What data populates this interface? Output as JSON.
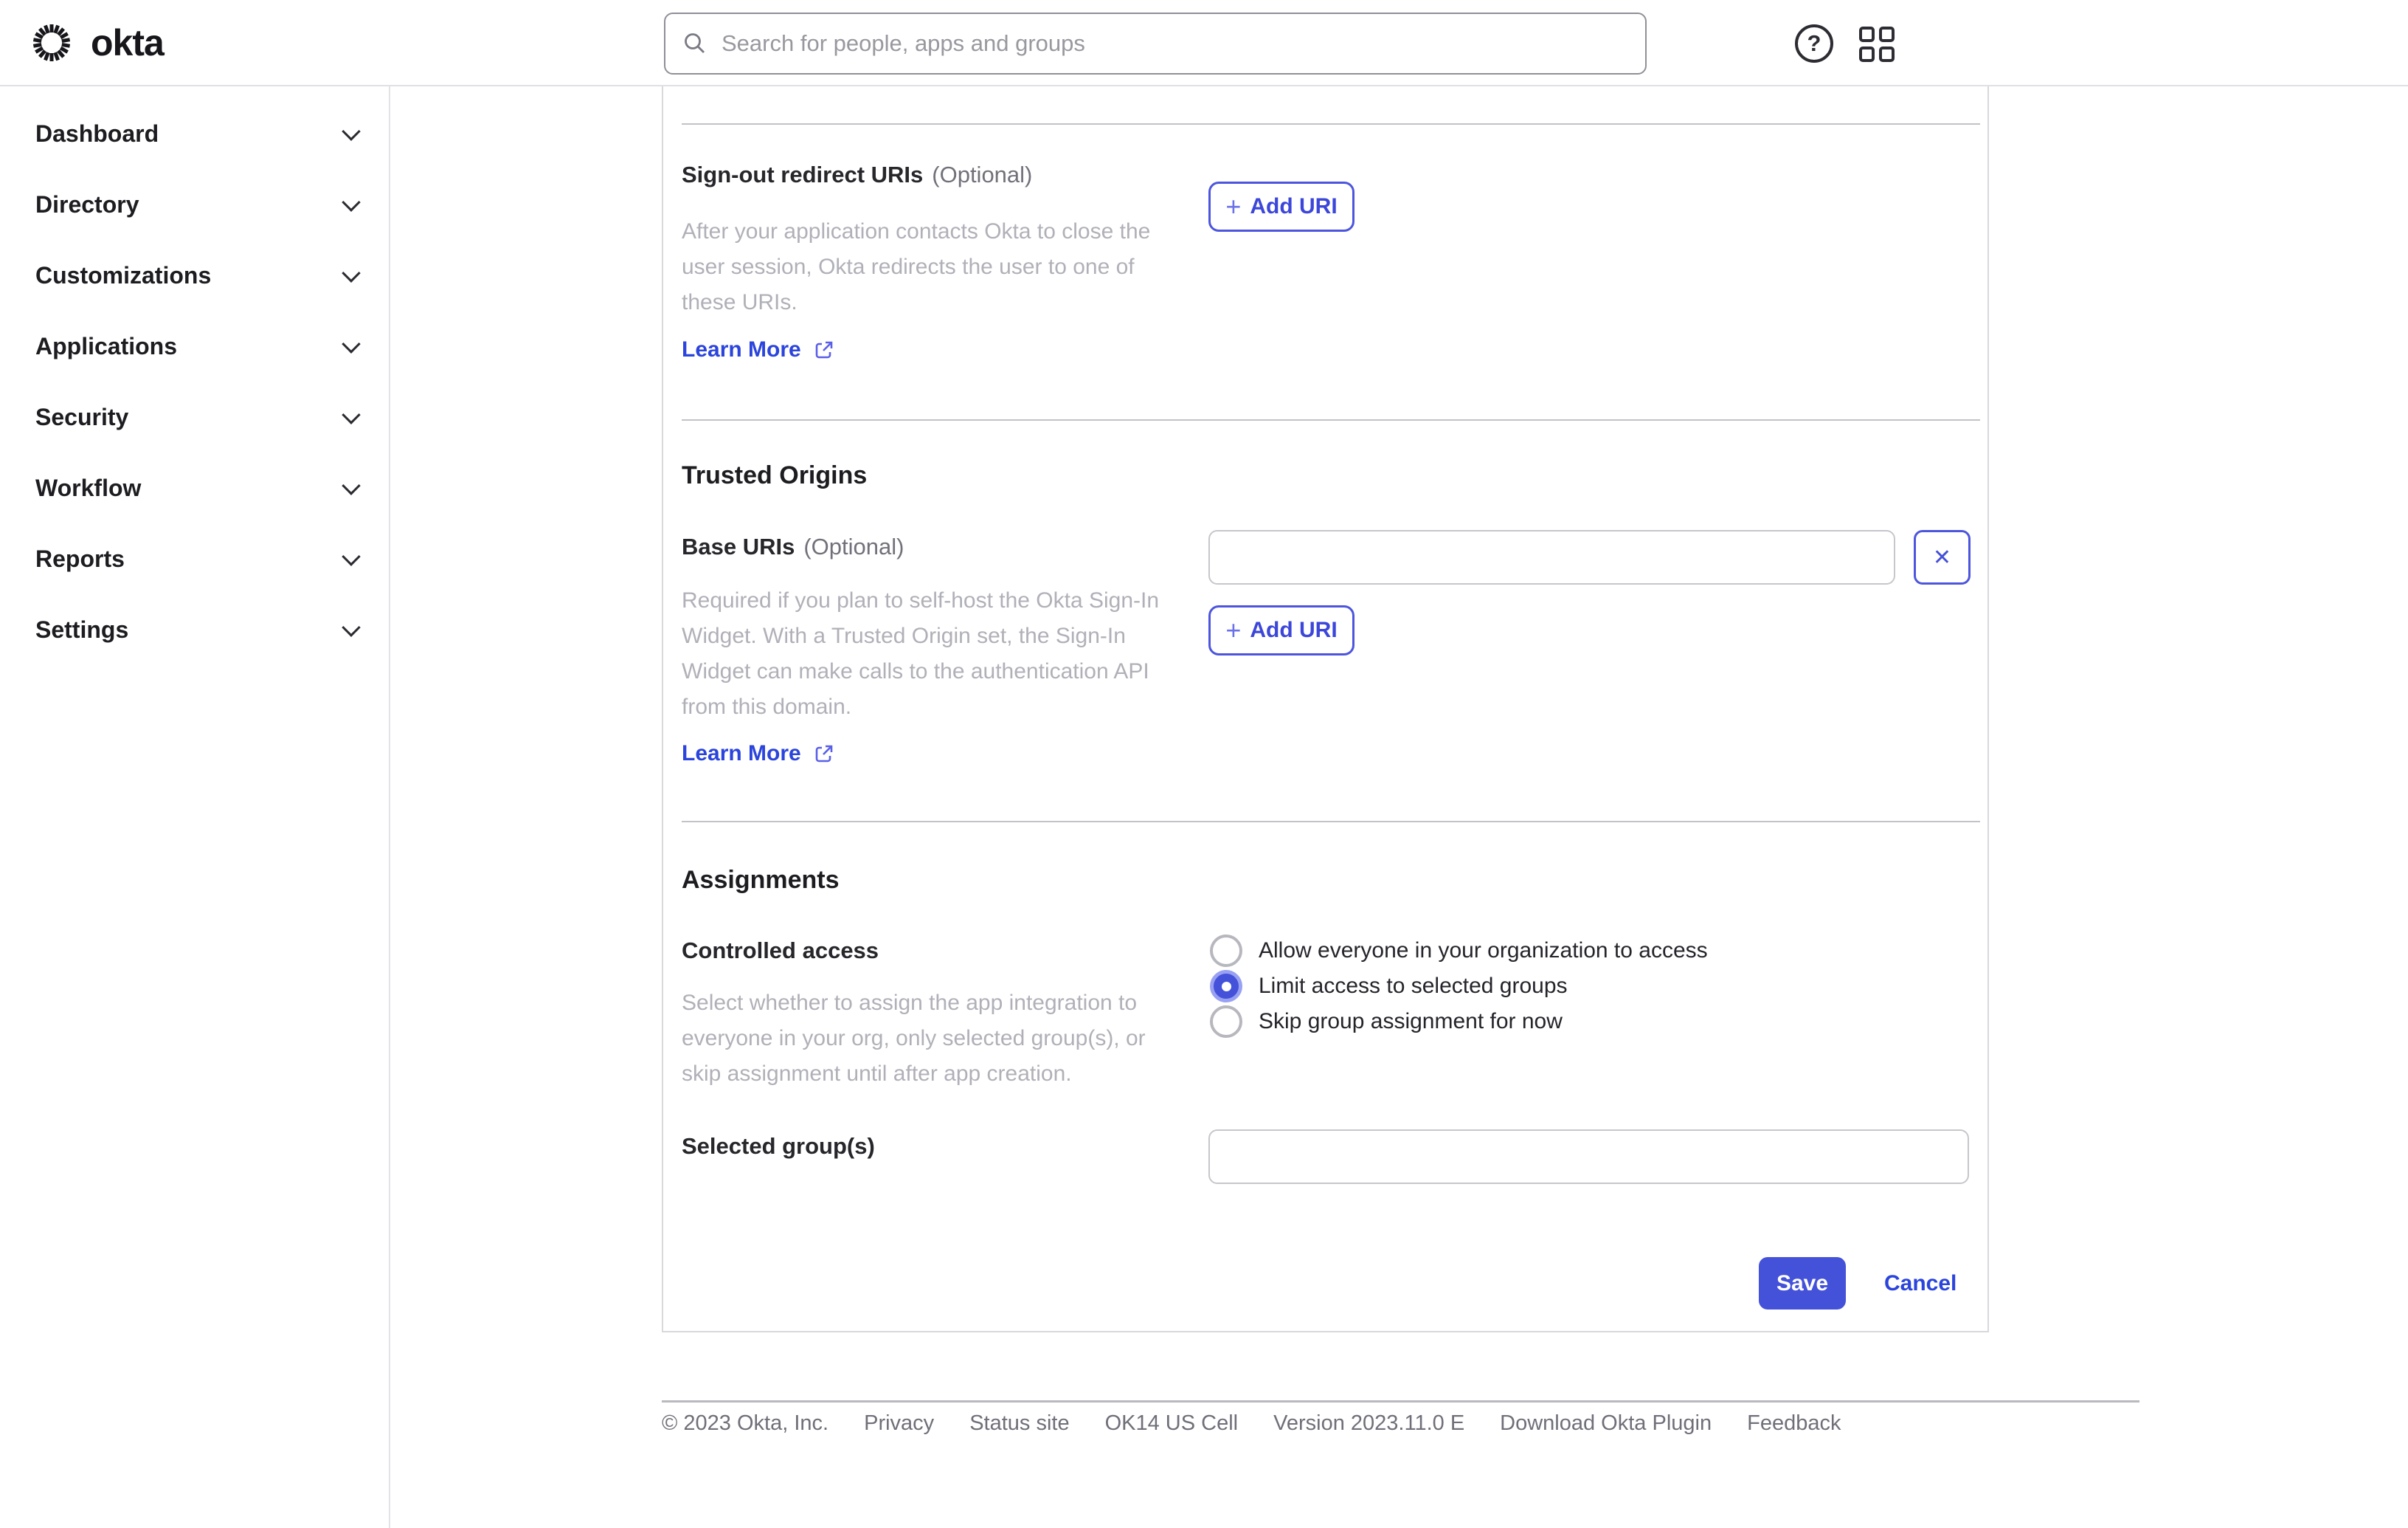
{
  "brand": {
    "logo_text": "okta"
  },
  "topbar": {
    "search_placeholder": "Search for people, apps and groups"
  },
  "sidebar": {
    "items": [
      {
        "label": "Dashboard"
      },
      {
        "label": "Directory"
      },
      {
        "label": "Customizations"
      },
      {
        "label": "Applications"
      },
      {
        "label": "Security"
      },
      {
        "label": "Workflow"
      },
      {
        "label": "Reports"
      },
      {
        "label": "Settings"
      }
    ]
  },
  "form": {
    "signout": {
      "label": "Sign-out redirect URIs",
      "optional": "(Optional)",
      "description": "After your application contacts Okta to close the user session, Okta redirects the user to one of these URIs.",
      "learn_more": "Learn More",
      "add_uri": "Add URI"
    },
    "trusted": {
      "heading": "Trusted Origins",
      "base_label": "Base URIs",
      "optional": "(Optional)",
      "description": "Required if you plan to self-host the Okta Sign-In Widget. With a Trusted Origin set, the Sign-In Widget can make calls to the authentication API from this domain.",
      "learn_more": "Learn More",
      "add_uri": "Add URI",
      "input_value": ""
    },
    "assignments": {
      "heading": "Assignments",
      "access_label": "Controlled access",
      "description": "Select whether to assign the app integration to everyone in your org, only selected group(s), or skip assignment until after app creation.",
      "options": [
        {
          "label": "Allow everyone in your organization to access",
          "selected": false
        },
        {
          "label": "Limit access to selected groups",
          "selected": true
        },
        {
          "label": "Skip group assignment for now",
          "selected": false
        }
      ],
      "groups_label": "Selected group(s)",
      "groups_value": ""
    },
    "actions": {
      "save": "Save",
      "cancel": "Cancel"
    }
  },
  "footer": {
    "items": [
      "© 2023 Okta, Inc.",
      "Privacy",
      "Status site",
      "OK14 US Cell",
      "Version 2023.11.0 E",
      "Download Okta Plugin",
      "Feedback"
    ]
  },
  "ui": {
    "plus_glyph": "+",
    "close_glyph": "✕"
  },
  "colors": {
    "primary": "#4451d9",
    "link": "#2b44dc",
    "text": "#1d1d21",
    "muted": "#6f6f79",
    "faint": "#b0b0b8",
    "input_border": "#c6c6cc",
    "divider": "#c2c2c8",
    "radio_ring": "#99a1f3"
  }
}
